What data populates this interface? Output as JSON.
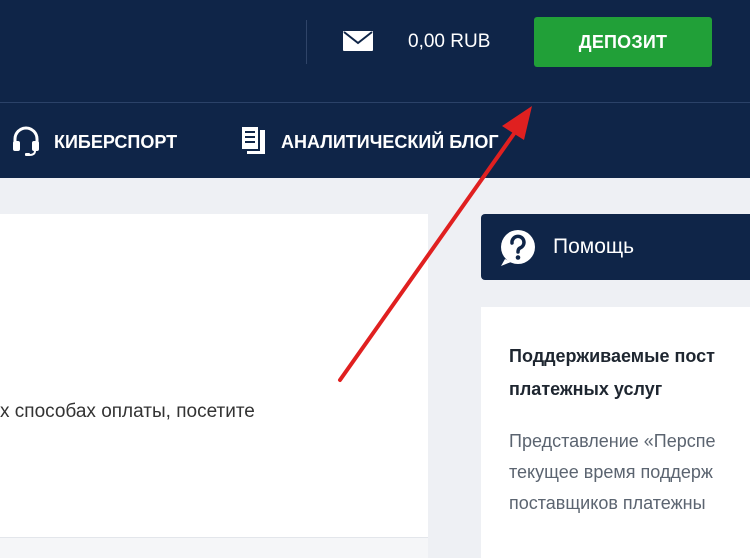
{
  "header": {
    "balance": "0,00 RUB",
    "deposit_label": "ДЕПОЗИТ",
    "mail_icon": "envelope-icon"
  },
  "nav": {
    "items": [
      {
        "label": "КИБЕРСПОРТ",
        "icon": "headset-icon"
      },
      {
        "label": "АНАЛИТИЧЕСКИЙ БЛОГ",
        "icon": "document-stack-icon"
      }
    ]
  },
  "content": {
    "text_fragment": "х способах оплаты, посетите"
  },
  "help": {
    "title": "Помощь",
    "icon": "question-bubble-icon",
    "card_title_line1": "Поддерживаемые пост",
    "card_title_line2": "платежных услуг",
    "card_body_line1": "Представление «Перспе",
    "card_body_line2": "текущее время поддерж",
    "card_body_line3": "поставщиков платежны"
  },
  "colors": {
    "header_bg": "#0f2548",
    "deposit_green": "#21a038",
    "arrow_red": "#e02020"
  }
}
